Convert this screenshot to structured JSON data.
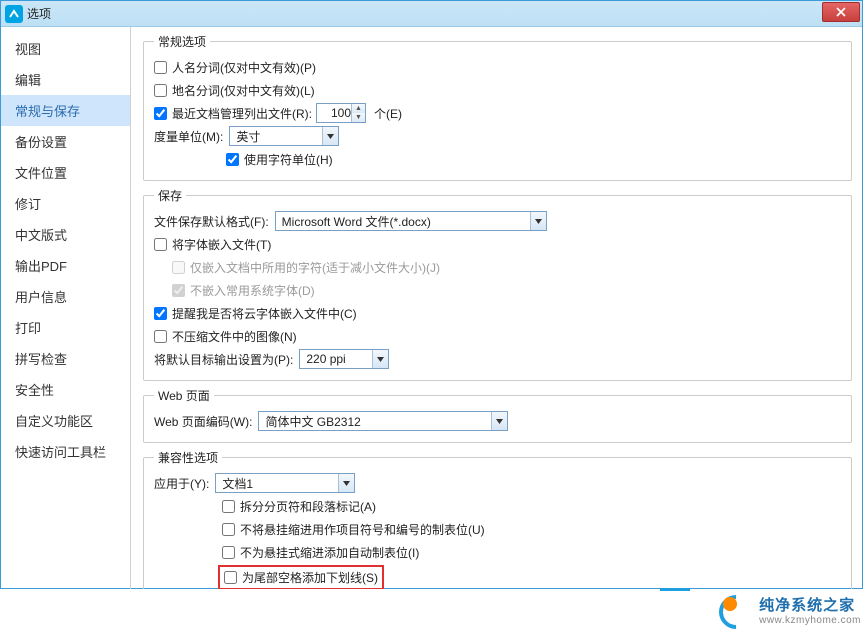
{
  "titlebar": {
    "title": "选项"
  },
  "sidebar": {
    "items": [
      "视图",
      "编辑",
      "常规与保存",
      "备份设置",
      "文件位置",
      "修订",
      "中文版式",
      "输出PDF",
      "用户信息",
      "打印",
      "拼写检查",
      "安全性",
      "自定义功能区",
      "快速访问工具栏"
    ],
    "active_index": 2
  },
  "general": {
    "legend": "常规选项",
    "cb_name_seg": "人名分词(仅对中文有效)(P)",
    "cb_place_seg": "地名分词(仅对中文有效)(L)",
    "cb_recent": "最近文档管理列出文件(R):",
    "recent_value": "100",
    "recent_unit": "个(E)",
    "measure_label": "度量单位(M):",
    "measure_value": "英寸",
    "cb_char_unit": "使用字符单位(H)"
  },
  "save": {
    "legend": "保存",
    "default_fmt_label": "文件保存默认格式(F):",
    "default_fmt_value": "Microsoft Word 文件(*.docx)",
    "cb_embed_fonts": "将字体嵌入文件(T)",
    "cb_only_used": "仅嵌入文档中所用的字符(适于减小文件大小)(J)",
    "cb_no_common": "不嵌入常用系统字体(D)",
    "cb_prompt_cloud": "提醒我是否将云字体嵌入文件中(C)",
    "cb_no_compress_img": "不压缩文件中的图像(N)",
    "target_out_label": "将默认目标输出设置为(P):",
    "target_out_value": "220 ppi"
  },
  "web": {
    "legend": "Web 页面",
    "encoding_label": "Web 页面编码(W):",
    "encoding_value": "简体中文 GB2312"
  },
  "compat": {
    "legend": "兼容性选项",
    "apply_label": "应用于(Y):",
    "apply_value": "文档1",
    "cb_split_page": "拆分分页符和段落标记(A)",
    "cb_no_hang_tab": "不将悬挂缩进用作项目符号和编号的制表位(U)",
    "cb_no_auto_tab": "不为悬挂式缩进添加自动制表位(I)",
    "cb_underline_trail": "为尾部空格添加下划线(S)"
  },
  "footer": {
    "brand": "纯净系统之家",
    "url": "www.kzmyhome.com"
  }
}
